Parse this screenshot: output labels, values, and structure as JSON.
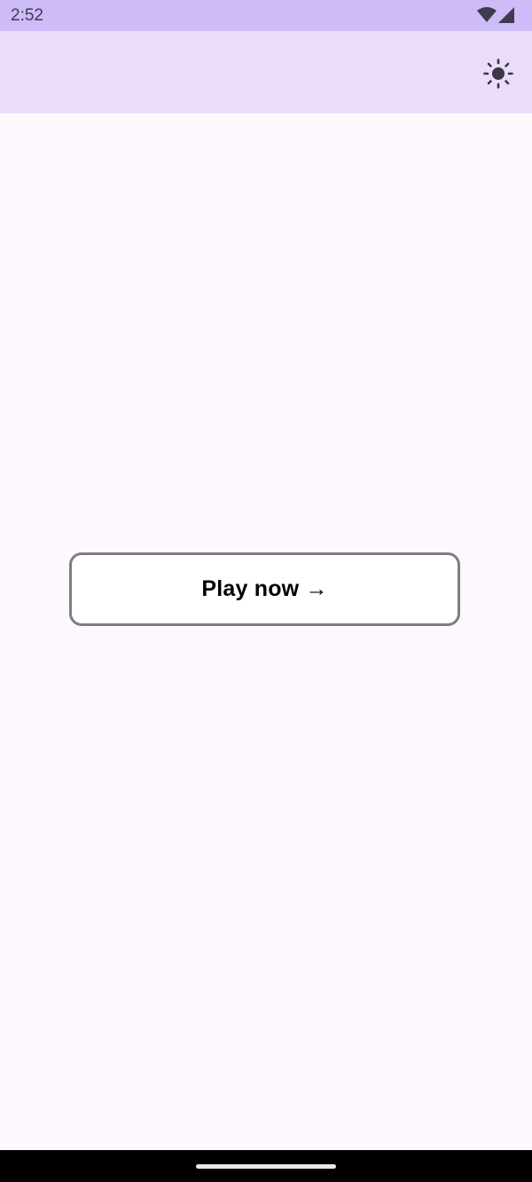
{
  "status_bar": {
    "time": "2:52",
    "icons": [
      "wifi-icon",
      "signal-icon"
    ]
  },
  "app_bar": {
    "theme_toggle_icon": "sun-icon"
  },
  "main": {
    "play_button_label": "Play now →"
  },
  "colors": {
    "status_bar_bg": "#cdbcf8",
    "app_bar_bg": "#ebdcfc",
    "page_bg": "#fdf8fd",
    "button_border": "#7f7c83",
    "nav_bar_bg": "#000000"
  }
}
